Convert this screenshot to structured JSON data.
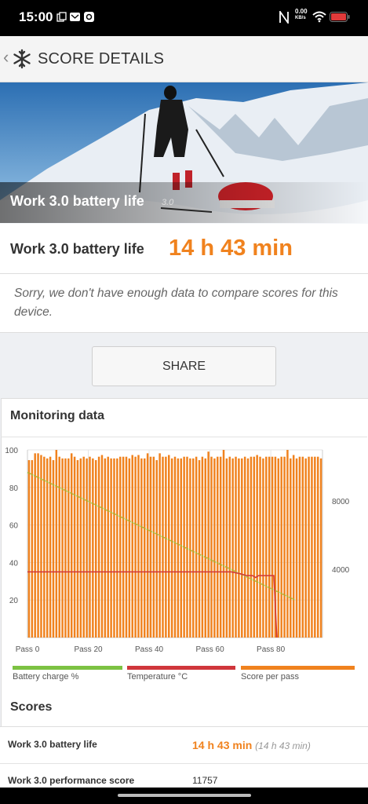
{
  "status": {
    "time": "15:00",
    "speed_value": "0.00",
    "speed_unit": "KB/s"
  },
  "appbar": {
    "title": "SCORE DETAILS"
  },
  "hero": {
    "label": "Work 3.0 battery life",
    "version": "3.0"
  },
  "result": {
    "name": "Work 3.0 battery life",
    "value": "14 h 43 min"
  },
  "notice": "Sorry, we don't have enough data to compare scores for this device.",
  "share_label": "SHARE",
  "monitoring": {
    "title": "Monitoring data",
    "legend": [
      {
        "label": "Battery charge %",
        "color": "#7cc242"
      },
      {
        "label": "Temperature °C",
        "color": "#d0363b"
      },
      {
        "label": "Score per pass",
        "color": "#f0821e"
      }
    ]
  },
  "chart_data": {
    "type": "bar",
    "x_tick_labels": [
      "Pass 0",
      "Pass 20",
      "Pass 40",
      "Pass 60",
      "Pass 80"
    ],
    "left_ticks": [
      "20",
      "40",
      "60",
      "80",
      "100"
    ],
    "right_ticks": [
      "4000",
      "8000"
    ],
    "xlim": [
      0,
      97
    ],
    "ylim_left": [
      0,
      100
    ],
    "ylim_right": [
      0,
      11000
    ],
    "series": [
      {
        "name": "Score per pass",
        "axis": "right",
        "values": [
          10400,
          10400,
          10800,
          10800,
          10700,
          10600,
          10500,
          10600,
          10400,
          11000,
          10600,
          10500,
          10500,
          10500,
          10800,
          10600,
          10400,
          10500,
          10600,
          10500,
          10600,
          10500,
          10400,
          10600,
          10700,
          10500,
          10600,
          10500,
          10500,
          10500,
          10600,
          10600,
          10600,
          10500,
          10700,
          10600,
          10700,
          10500,
          10500,
          10800,
          10600,
          10600,
          10400,
          10800,
          10600,
          10600,
          10700,
          10500,
          10600,
          10500,
          10500,
          10600,
          10600,
          10500,
          10500,
          10600,
          10400,
          10600,
          10500,
          10900,
          10600,
          10500,
          10600,
          10600,
          11000,
          10500,
          10600,
          10500,
          10600,
          10500,
          10500,
          10600,
          10500,
          10600,
          10600,
          10700,
          10600,
          10500,
          10600,
          10600,
          10600,
          10600,
          10500,
          10600,
          10600,
          11000,
          10500,
          10700,
          10500,
          10600,
          10600,
          10500,
          10600,
          10600,
          10600,
          10600,
          10500
        ]
      },
      {
        "name": "Battery charge %",
        "axis": "left",
        "x": [
          0,
          88
        ],
        "values": [
          88,
          20
        ]
      },
      {
        "name": "Temperature °C",
        "axis": "left",
        "x": [
          0,
          22,
          67,
          70,
          72,
          74,
          75,
          76,
          78,
          81,
          82
        ],
        "values": [
          35,
          35,
          35,
          34,
          33,
          33,
          32,
          33,
          33,
          33,
          0
        ]
      }
    ]
  },
  "scores": {
    "title": "Scores",
    "rows": [
      {
        "label": "Work 3.0 battery life",
        "value": "14 h 43 min",
        "sub": "(14 h 43 min)"
      },
      {
        "label": "Work 3.0 performance score",
        "value": "11757"
      }
    ]
  }
}
